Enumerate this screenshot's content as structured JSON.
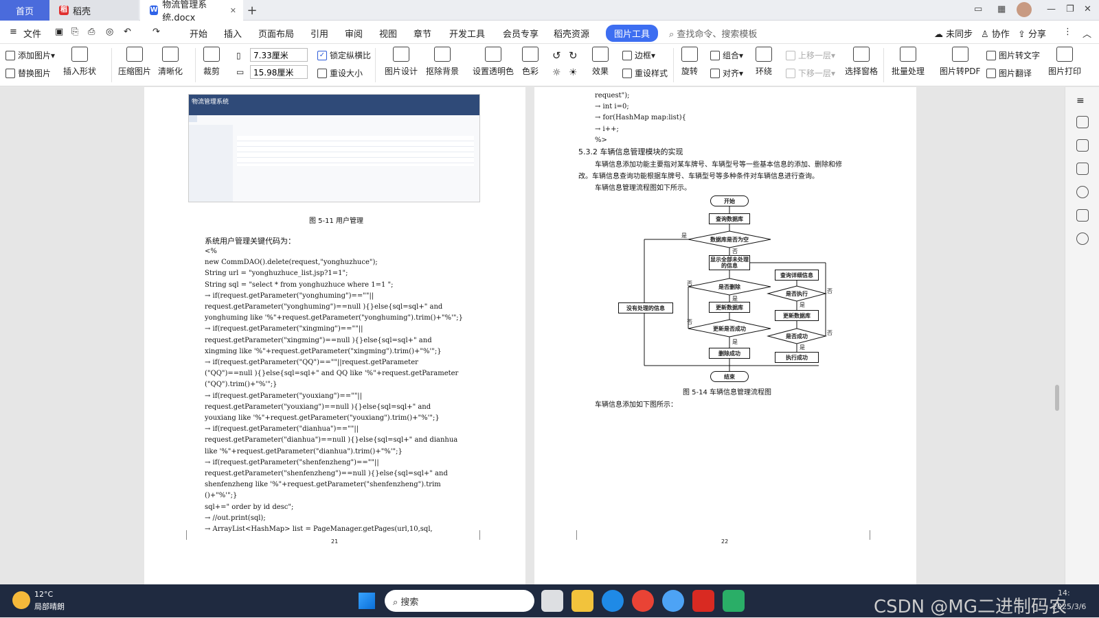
{
  "tabs": {
    "home": "首页",
    "daoke": "稻壳",
    "doc": "物流管理系统.docx"
  },
  "menu": {
    "file": "文件",
    "items": [
      "开始",
      "插入",
      "页面布局",
      "引用",
      "审阅",
      "视图",
      "章节",
      "开发工具",
      "会员专享",
      "稻壳资源"
    ],
    "active": "图片工具",
    "search": "查找命令、搜索模板",
    "sync": "未同步",
    "collab": "协作",
    "share": "分享"
  },
  "toolbar": {
    "add_pic": "添加图片",
    "replace_pic": "替换图片",
    "insert_shape": "插入形状",
    "compress": "压缩图片",
    "sharpen": "清晰化",
    "crop": "裁剪",
    "width": "7.33厘米",
    "height": "15.98厘米",
    "lock_ratio": "锁定纵横比",
    "resize": "重设大小",
    "pic_design": "图片设计",
    "remove_bg": "抠除背景",
    "set_transparent": "设置透明色",
    "color": "色彩",
    "effect": "效果",
    "border": "边框",
    "reset_style": "重设样式",
    "rotate": "旋转",
    "group": "组合",
    "align": "对齐",
    "wrap": "环绕",
    "up_layer": "上移一层",
    "down_layer": "下移一层",
    "select_pane": "选择窗格",
    "batch": "批量处理",
    "to_pdf": "图片转PDF",
    "to_text": "图片转文字",
    "translate": "图片翻译",
    "print": "图片打印"
  },
  "left_page": {
    "screenshot": {
      "title": "物流管理系统"
    },
    "caption": "图 5-11 用户管理",
    "intro": "系统用户管理关键代码为：",
    "code": [
      "<%",
      "new CommDAO().delete(request,\"yonghuzhuce\");",
      "String url = \"yonghuzhuce_list.jsp?1=1\";",
      "String sql =  \"select * from yonghuzhuce where 1=1 \";",
      "→ if(request.getParameter(\"yonghuming\")==\"\"||",
      "request.getParameter(\"yonghuming\")==null ){}else{sql=sql+\" and",
      "yonghuming like '%\"+request.getParameter(\"yonghuming\").trim()+\"%'\";}",
      "→ if(request.getParameter(\"xingming\")==\"\"||",
      "request.getParameter(\"xingming\")==null ){}else{sql=sql+\" and",
      "xingming like '%\"+request.getParameter(\"xingming\").trim()+\"%'\";}",
      "→ if(request.getParameter(\"QQ\")==\"\"||request.getParameter",
      "(\"QQ\")==null ){}else{sql=sql+\" and QQ like '%\"+request.getParameter",
      "(\"QQ\").trim()+\"%'\";}",
      "→ if(request.getParameter(\"youxiang\")==\"\"||",
      "request.getParameter(\"youxiang\")==null ){}else{sql=sql+\" and",
      "youxiang like '%\"+request.getParameter(\"youxiang\").trim()+\"%'\";}",
      "→ if(request.getParameter(\"dianhua\")==\"\"||",
      "request.getParameter(\"dianhua\")==null ){}else{sql=sql+\" and dianhua",
      "like '%\"+request.getParameter(\"dianhua\").trim()+\"%'\";}",
      "→ if(request.getParameter(\"shenfenzheng\")==\"\"||",
      "request.getParameter(\"shenfenzheng\")==null ){}else{sql=sql+\" and",
      "shenfenzheng like '%\"+request.getParameter(\"shenfenzheng\").trim",
      "()+\"%'\";}",
      "sql+=\" order by id desc\";",
      "→ //out.print(sql);",
      "→ ArrayList<HashMap> list = PageManager.getPages(url,10,sql,"
    ],
    "page_no": "21"
  },
  "right_page": {
    "code": [
      "request\");",
      "→ int i=0;",
      "→ for(HashMap map:list){",
      "→ i++;",
      "%>"
    ],
    "heading": "5.3.2 车辆信息管理模块的实现",
    "para1": "车辆信息添加功能主要指对某车牌号、车辆型号等一些基本信息的添加、删除和修",
    "para2": "改。车辆信息查询功能根据车牌号、车辆型号等多种条件对车辆信息进行查询。",
    "para3": "车辆信息管理流程图如下所示。",
    "flow": {
      "start": "开始",
      "query_db": "查询数据库",
      "is_empty": "数据库是否为空",
      "show_all": "显示全部未处理的信息",
      "query_detail": "查询详细信息",
      "is_delete": "是否删除",
      "is_exec": "是否执行",
      "update1": "更新数据库",
      "update2": "更新数据库",
      "update_ok": "更新是否成功",
      "is_ok": "是否成功",
      "delete_ok": "删除成功",
      "exec_ok": "执行成功",
      "no_info": "没有处理的信息",
      "end": "结束",
      "yes": "是",
      "no": "否"
    },
    "caption": "图 5-14 车辆信息管理流程图",
    "para4": "车辆信息添加如下图所示：",
    "page_no": "22"
  },
  "taskbar": {
    "temp": "12°C",
    "weather": "局部晴朗",
    "search": "搜索",
    "watermark": "CSDN @MG二进制码农",
    "date": "2025/3/6",
    "time": "14:"
  }
}
